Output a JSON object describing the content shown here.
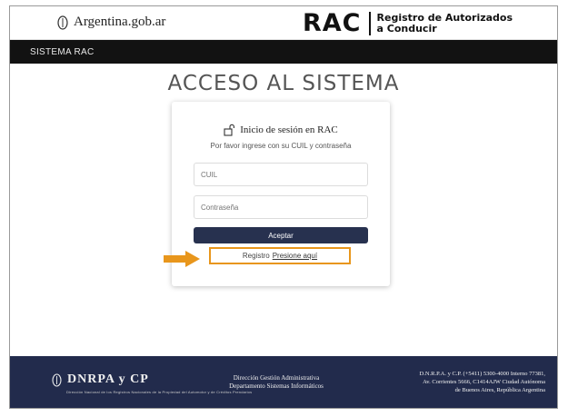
{
  "header": {
    "gov_site": "Argentina.gob.ar",
    "rac_logo": "RAC",
    "rac_subtitle_line1": "Registro de Autorizados",
    "rac_subtitle_line2": "a Conducir"
  },
  "system_bar": {
    "label": "SISTEMA RAC"
  },
  "main": {
    "title": "ACCESO AL SISTEMA"
  },
  "login": {
    "lock_icon": "lock-open-icon",
    "title": "Inicio de sesión en RAC",
    "subtitle": "Por favor ingrese con su CUIL y contraseña",
    "cuil_placeholder": "CUIL",
    "password_placeholder": "Contraseña",
    "accept_label": "Aceptar",
    "register_prefix": "Registro",
    "register_link": "Presione aquí"
  },
  "footer": {
    "org": "DNRPA y CP",
    "org_sub": "Dirección Nacional de los Registros Nacionales de la Propiedad del Automotor y de Créditos Prendarios",
    "mid_line1": "Dirección Gestión Administrativa",
    "mid_line2": "Departamento Sistemas Informáticos",
    "right_line1": "D.N.R.P.A. y C.P. (+5411) 5300-4000 Interno 77381,",
    "right_line2": "Av. Corrientes 5666, C1414AJW Ciudad Autónoma",
    "right_line3": "de Buenos Aires, República Argentina"
  },
  "colors": {
    "navy": "#222b4c",
    "button": "#27314f",
    "highlight": "#e8961c",
    "sysbar": "#121212"
  }
}
